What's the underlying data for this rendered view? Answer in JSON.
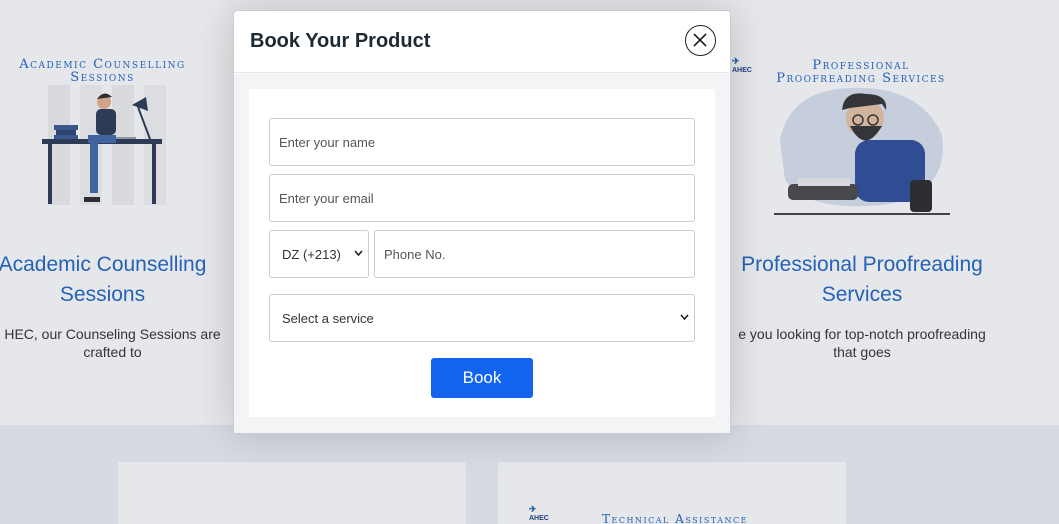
{
  "background": {
    "left_card": {
      "image_title_line1": "Academic Counselling",
      "image_title_line2": "Sessions",
      "title_line1": "Academic Counselling",
      "title_line2": "Sessions",
      "text_line1": "HEC, our Counseling Sessions are",
      "text_line2": "crafted to"
    },
    "right_card": {
      "image_title_line1": "Professional",
      "image_title_line2": "Proofreading Services",
      "title_line1": "Professional Proofreading",
      "title_line2": "Services",
      "text_line1": "e you looking for top-notch proofreading",
      "text_line2": "that goes",
      "logo": "AHEC"
    },
    "lower_card": {
      "logo": "AHEC",
      "image_title": "Technical Assistance"
    }
  },
  "modal": {
    "title": "Book Your Product",
    "close_icon": "close-icon",
    "form": {
      "name_placeholder": "Enter your name",
      "email_placeholder": "Enter your email",
      "country_code": "DZ (+213)",
      "phone_placeholder": "Phone No.",
      "service_placeholder": "Select a service",
      "submit_label": "Book"
    }
  },
  "colors": {
    "accent": "#1264f0",
    "heading_blue": "#2067c7",
    "modal_title": "#1f2933"
  }
}
